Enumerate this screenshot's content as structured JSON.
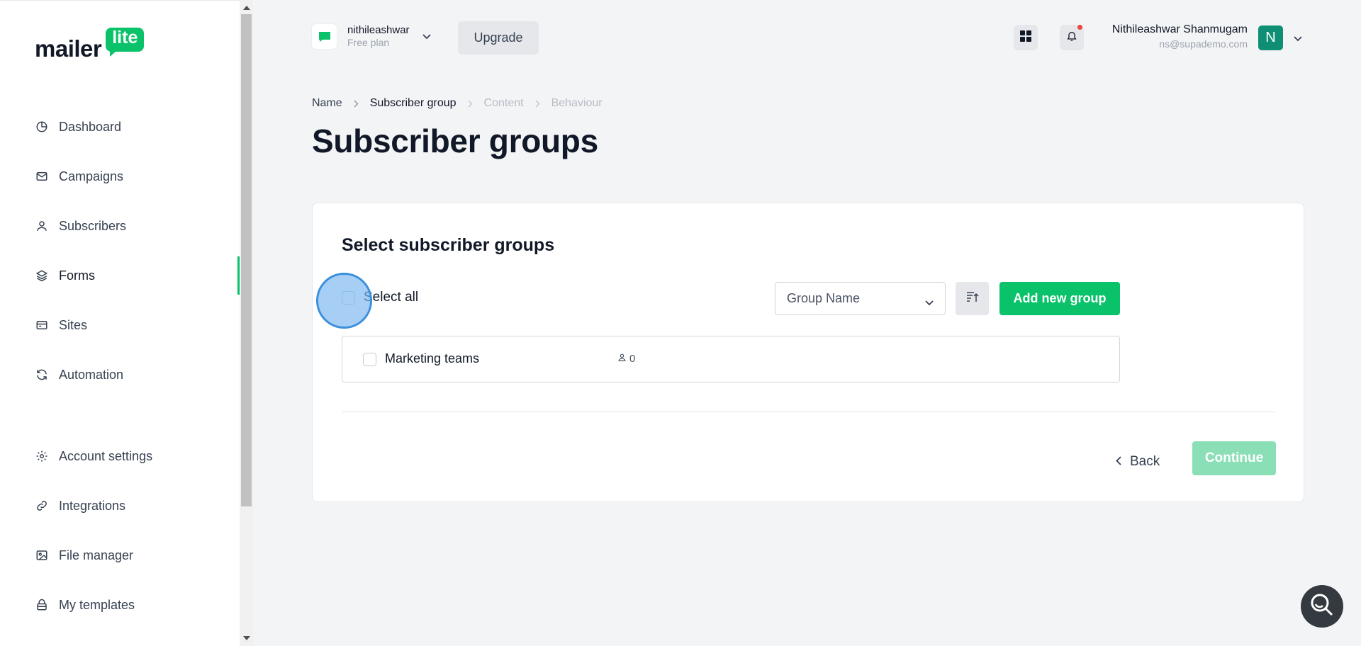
{
  "brand": {
    "logo_text": "mailer",
    "logo_badge": "lite",
    "accent": "#09c269"
  },
  "sidebar": {
    "items": [
      {
        "label": "Dashboard",
        "icon": "pie-chart-icon"
      },
      {
        "label": "Campaigns",
        "icon": "envelope-icon"
      },
      {
        "label": "Subscribers",
        "icon": "user-icon"
      },
      {
        "label": "Forms",
        "icon": "layers-icon",
        "active": true
      },
      {
        "label": "Sites",
        "icon": "browser-icon"
      },
      {
        "label": "Automation",
        "icon": "refresh-icon"
      },
      {
        "label": "Account settings",
        "icon": "gear-icon"
      },
      {
        "label": "Integrations",
        "icon": "link-icon"
      },
      {
        "label": "File manager",
        "icon": "image-icon"
      },
      {
        "label": "My templates",
        "icon": "template-icon"
      }
    ]
  },
  "header": {
    "account_name": "nithileashwar",
    "account_plan": "Free plan",
    "upgrade_label": "Upgrade",
    "user_name": "Nithileashwar Shanmugam",
    "user_email": "ns@supademo.com",
    "avatar_initial": "N"
  },
  "breadcrumb": [
    {
      "label": "Name",
      "state": "done"
    },
    {
      "label": "Subscriber group",
      "state": "current"
    },
    {
      "label": "Content",
      "state": "disabled"
    },
    {
      "label": "Behaviour",
      "state": "disabled"
    }
  ],
  "page": {
    "title": "Subscriber groups"
  },
  "card": {
    "title": "Select subscriber groups",
    "select_all_label": "Select all",
    "sort_selected": "Group Name",
    "add_group_label": "Add new group",
    "groups": [
      {
        "name": "Marketing teams",
        "count": "0"
      }
    ],
    "back_label": "Back",
    "continue_label": "Continue"
  }
}
